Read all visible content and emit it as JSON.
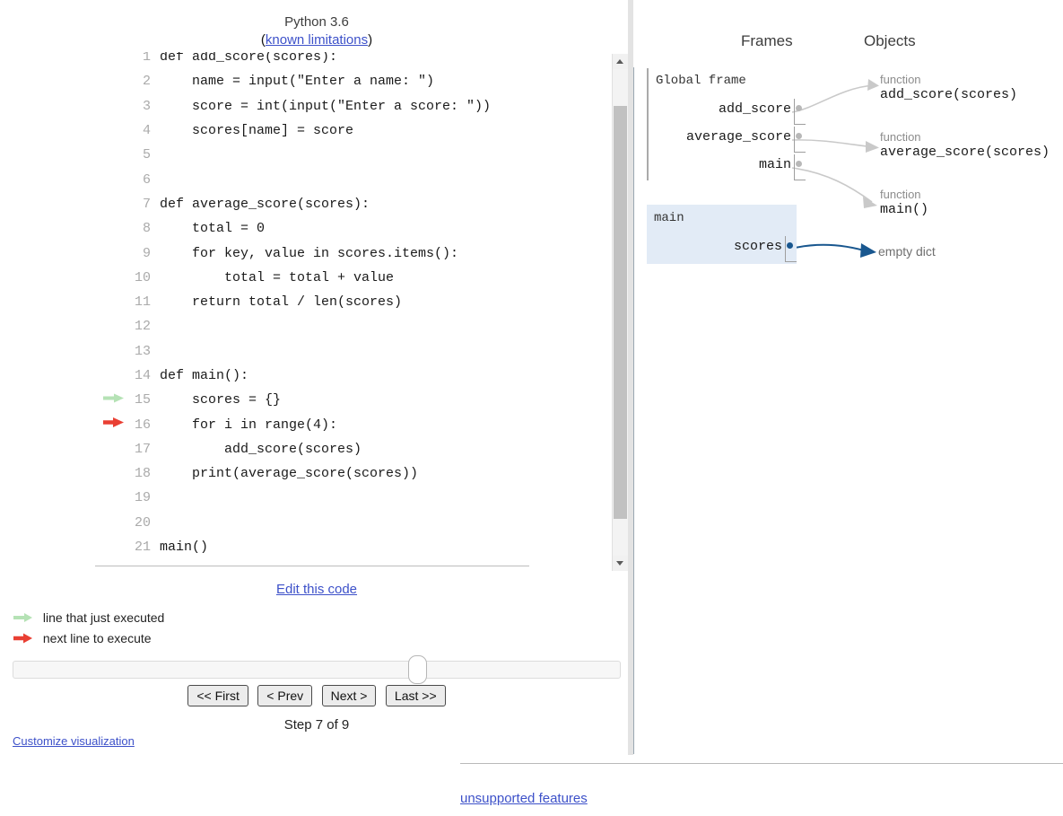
{
  "header": {
    "python_version": "Python 3.6",
    "limitations_prefix": "(",
    "limitations_link": "known limitations",
    "limitations_suffix": ")"
  },
  "code": {
    "lines": [
      {
        "num": "1",
        "text": "def add_score(scores):",
        "marker": ""
      },
      {
        "num": "2",
        "text": "    name = input(\"Enter a name: \")",
        "marker": ""
      },
      {
        "num": "3",
        "text": "    score = int(input(\"Enter a score: \"))",
        "marker": ""
      },
      {
        "num": "4",
        "text": "    scores[name] = score",
        "marker": ""
      },
      {
        "num": "5",
        "text": "",
        "marker": ""
      },
      {
        "num": "6",
        "text": "",
        "marker": ""
      },
      {
        "num": "7",
        "text": "def average_score(scores):",
        "marker": ""
      },
      {
        "num": "8",
        "text": "    total = 0",
        "marker": ""
      },
      {
        "num": "9",
        "text": "    for key, value in scores.items():",
        "marker": ""
      },
      {
        "num": "10",
        "text": "        total = total + value",
        "marker": ""
      },
      {
        "num": "11",
        "text": "    return total / len(scores)",
        "marker": ""
      },
      {
        "num": "12",
        "text": "",
        "marker": ""
      },
      {
        "num": "13",
        "text": "",
        "marker": ""
      },
      {
        "num": "14",
        "text": "def main():",
        "marker": ""
      },
      {
        "num": "15",
        "text": "    scores = {}",
        "marker": "executed"
      },
      {
        "num": "16",
        "text": "    for i in range(4):",
        "marker": "next"
      },
      {
        "num": "17",
        "text": "        add_score(scores)",
        "marker": ""
      },
      {
        "num": "18",
        "text": "    print(average_score(scores))",
        "marker": ""
      },
      {
        "num": "19",
        "text": "",
        "marker": ""
      },
      {
        "num": "20",
        "text": "",
        "marker": ""
      },
      {
        "num": "21",
        "text": "main()",
        "marker": ""
      }
    ]
  },
  "controls": {
    "edit_code": "Edit this code",
    "legend_executed": "line that just executed",
    "legend_next": "next line to execute",
    "first": "<< First",
    "prev": "< Prev",
    "next": "Next >",
    "last": "Last >>",
    "step_label": "Step 7 of 9",
    "customize": "Customize visualization"
  },
  "viz": {
    "frames_heading": "Frames",
    "objects_heading": "Objects",
    "global_frame": {
      "title": "Global frame",
      "vars": [
        {
          "name": "add_score",
          "pointer": true
        },
        {
          "name": "average_score",
          "pointer": true
        },
        {
          "name": "main",
          "pointer": true
        }
      ]
    },
    "current_frame": {
      "title": "main",
      "vars": [
        {
          "name": "scores",
          "pointer": true
        }
      ]
    },
    "objects": [
      {
        "kind": "function",
        "value": "add_score(scores)"
      },
      {
        "kind": "function",
        "value": "average_score(scores)"
      },
      {
        "kind": "function",
        "value": "main()"
      }
    ],
    "empty_dict_label": "empty dict"
  },
  "footer": {
    "unsupported_features": "unsupported features"
  },
  "colors": {
    "link": "#3d51c9",
    "executed_arrow": "#b5e2b5",
    "next_arrow": "#e93f33",
    "current_frame_bg": "#e2ebf6",
    "active_pointer": "#19578f",
    "inactive_pointer": "#b8b8b8"
  }
}
